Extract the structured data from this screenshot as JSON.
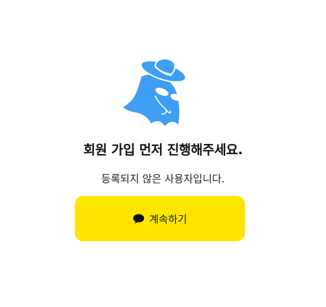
{
  "dialog": {
    "illustration_icon": "masked-ghost-with-hat-icon",
    "title": "회원 가입 먼저 진행해주세요.",
    "subtitle": "등록되지 않은 사용자입니다.",
    "continue_button": {
      "icon": "chat-bubble-icon",
      "label": "계속하기"
    }
  },
  "colors": {
    "illustration": "#3d9ef2",
    "button_bg": "#FEE500",
    "button_text": "#1b1b1b",
    "title_text": "#111111"
  }
}
